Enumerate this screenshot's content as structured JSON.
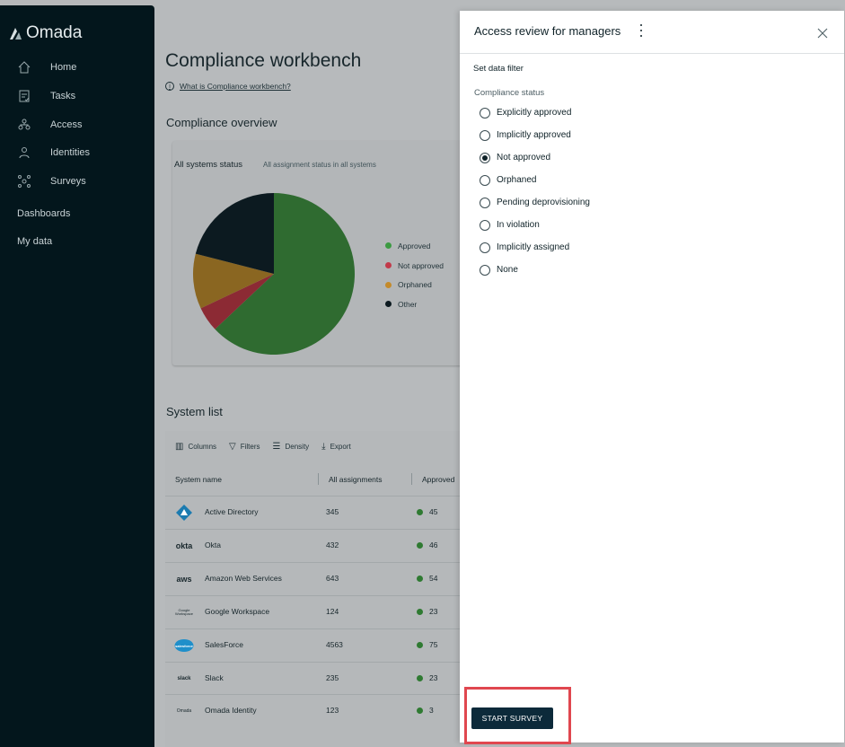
{
  "brand": {
    "name": "Omada"
  },
  "nav": {
    "items": [
      {
        "label": "Home",
        "icon": "home-icon"
      },
      {
        "label": "Tasks",
        "icon": "tasks-icon"
      },
      {
        "label": "Access",
        "icon": "access-icon"
      },
      {
        "label": "Identities",
        "icon": "identities-icon"
      },
      {
        "label": "Surveys",
        "icon": "surveys-icon"
      }
    ],
    "dashboards": "Dashboards",
    "my_data": "My data"
  },
  "main": {
    "title": "Compliance workbench",
    "help_link": "What is Compliance workbench?",
    "overview_title": "Compliance overview",
    "card_title": "All systems status",
    "card_subtitle": "All assignment status in all systems",
    "system_list_title": "System list",
    "toolbar": {
      "columns": "Columns",
      "filters": "Filters",
      "density": "Density",
      "export": "Export"
    },
    "columns": {
      "system_name": "System name",
      "all_assignments": "All assignments",
      "approved": "Approved"
    },
    "rows": [
      {
        "logo": "active-directory-logo",
        "logo_text": "",
        "name": "Active Directory",
        "count": "345",
        "approved": "45"
      },
      {
        "logo": "okta-logo",
        "logo_text": "okta",
        "name": "Okta",
        "count": "432",
        "approved": "46"
      },
      {
        "logo": "aws-logo",
        "logo_text": "aws",
        "name": "Amazon Web Services",
        "count": "643",
        "approved": "54"
      },
      {
        "logo": "google-workspace-logo",
        "logo_text": "Google Workspace",
        "name": "Google Workspace",
        "count": "124",
        "approved": "23"
      },
      {
        "logo": "salesforce-logo",
        "logo_text": "salesforce",
        "name": "SalesForce",
        "count": "4563",
        "approved": "75"
      },
      {
        "logo": "slack-logo",
        "logo_text": "slack",
        "name": "Slack",
        "count": "235",
        "approved": "23"
      },
      {
        "logo": "omada-logo",
        "logo_text": "Omada",
        "name": "Omada Identity",
        "count": "123",
        "approved": "3"
      }
    ]
  },
  "chart_data": {
    "type": "pie",
    "title": "All systems status",
    "subtitle": "All assignment status in all systems",
    "categories": [
      "Approved",
      "Not approved",
      "Orphaned",
      "Other"
    ],
    "values": [
      63,
      5,
      11,
      21
    ],
    "colors": [
      "#2f6b30",
      "#8c2a34",
      "#8a6621",
      "#0c1a20"
    ],
    "legend_placement": "right"
  },
  "panel": {
    "title": "Access review for managers",
    "filter_heading": "Set data filter",
    "field_label": "Compliance status",
    "options": [
      {
        "label": "Explicitly approved",
        "selected": false
      },
      {
        "label": "Implicitly approved",
        "selected": false
      },
      {
        "label": "Not approved",
        "selected": true
      },
      {
        "label": "Orphaned",
        "selected": false
      },
      {
        "label": "Pending deprovisioning",
        "selected": false
      },
      {
        "label": "In violation",
        "selected": false
      },
      {
        "label": "Implicitly assigned",
        "selected": false
      },
      {
        "label": "None",
        "selected": false
      }
    ],
    "start_button": "START SURVEY"
  },
  "colors": {
    "sidebar": "#03161c",
    "primary_button": "#0c2a3a",
    "highlight": "#e0474f",
    "approved_dot": "#2f7a32"
  }
}
